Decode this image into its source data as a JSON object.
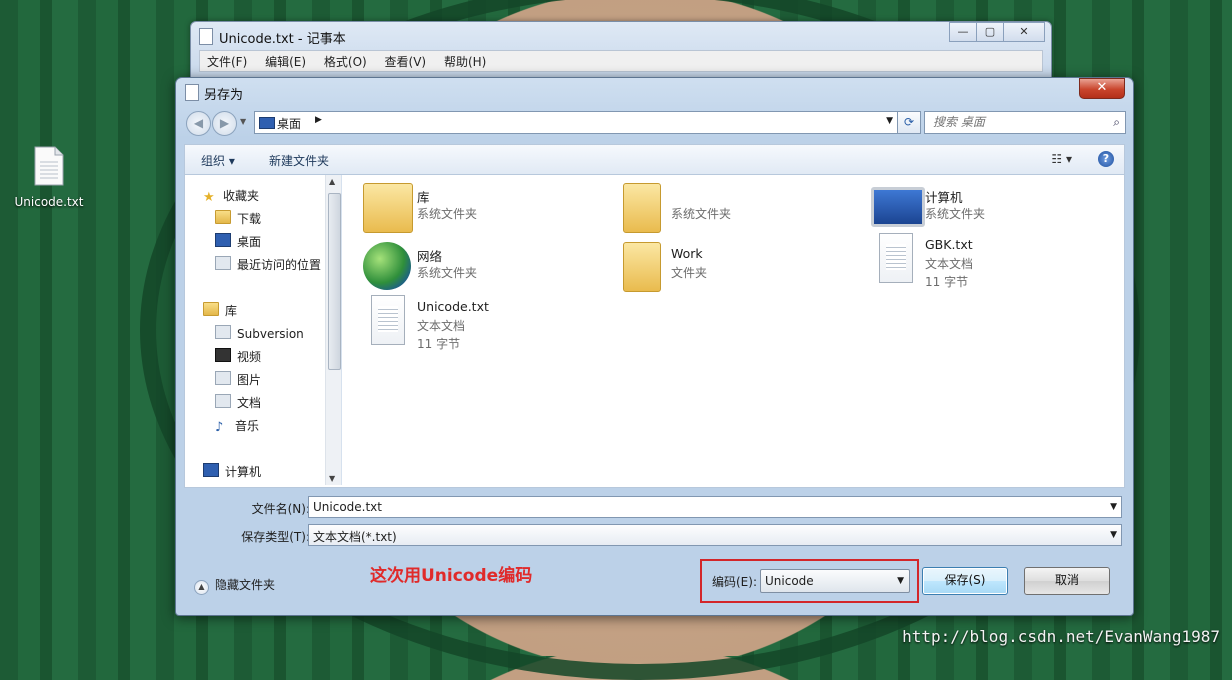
{
  "desktop": {
    "file_icon_label": "Unicode.txt",
    "watermark": "http://blog.csdn.net/EvanWang1987"
  },
  "notepad": {
    "title": "Unicode.txt - 记事本",
    "menu": [
      "文件(F)",
      "编辑(E)",
      "格式(O)",
      "查看(V)",
      "帮助(H)"
    ]
  },
  "dialog": {
    "title": "另存为",
    "close_label": "✕",
    "address": {
      "location": "桌面"
    },
    "search": {
      "placeholder": "搜索 桌面"
    },
    "toolbar": {
      "organize": "组织 ▾",
      "new_folder": "新建文件夹",
      "help": "?"
    },
    "nav_pane": {
      "favorites": "收藏夹",
      "downloads": "下载",
      "desktop": "桌面",
      "recent": "最近访问的位置",
      "libraries": "库",
      "subversion": "Subversion",
      "videos": "视频",
      "pictures": "图片",
      "documents": "文档",
      "music": "音乐",
      "computer": "计算机"
    },
    "files": [
      {
        "name": "库",
        "type": "系统文件夹",
        "size": "",
        "icon": "library-folder-icon"
      },
      {
        "name": "",
        "type": "系统文件夹",
        "size": "",
        "icon": "user-folder-icon"
      },
      {
        "name": "计算机",
        "type": "系统文件夹",
        "size": "",
        "icon": "computer-icon"
      },
      {
        "name": "网络",
        "type": "系统文件夹",
        "size": "",
        "icon": "network-globe-icon"
      },
      {
        "name": "Work",
        "type": "文件夹",
        "size": "",
        "icon": "folder-icon"
      },
      {
        "name": "GBK.txt",
        "type": "文本文档",
        "size": "11 字节",
        "icon": "text-document-icon"
      },
      {
        "name": "Unicode.txt",
        "type": "文本文档",
        "size": "11 字节",
        "icon": "text-document-icon"
      }
    ],
    "filename": {
      "label": "文件名(N):",
      "value": "Unicode.txt"
    },
    "filetype": {
      "label": "保存类型(T):",
      "value": "文本文档(*.txt)"
    },
    "hide_folders": "隐藏文件夹",
    "annotation": "这次用Unicode编码",
    "encoding": {
      "label": "编码(E):",
      "value": "Unicode"
    },
    "save_button": "保存(S)",
    "cancel_button": "取消"
  }
}
